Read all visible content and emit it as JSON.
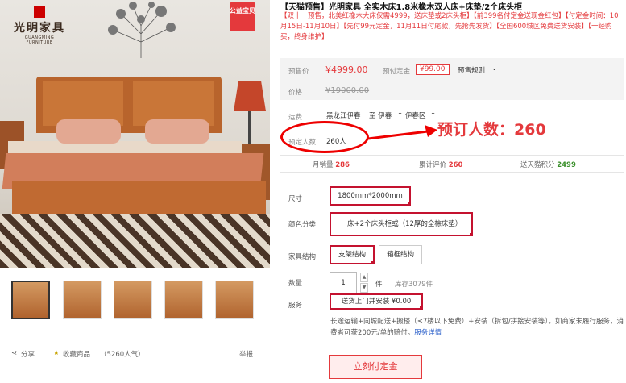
{
  "gallery": {
    "logo_cn": "光明家具",
    "logo_en": "GUANGMING FURNITURE",
    "promo_badge": "公益宝贝",
    "thumbnail_count": 5,
    "share_label": "分享",
    "favorite_label": "收藏商品",
    "favorite_count": "（5260人气）",
    "report_label": "举报"
  },
  "product": {
    "title": "【天猫预售】光明家具 全实木床1.8米橡木双人床+床垫/2个床头柜",
    "subtitle": "【双十一预售，北美红橡木大床仅需4999，送床垫或2床头柜】【前399名付定金送现金红包】【付定金时间：10月15日-11月10日】【先付99元定金，11月11日付尾款，先抢先发货】【全国600城区免费送货安装】【一经购买，终身维护】"
  },
  "price": {
    "presale_label": "预售价",
    "presale_price": "¥4999.00",
    "deposit_label": "预付定金",
    "deposit_price": "¥99.00",
    "rule_label": "预售规则",
    "original_label": "价格",
    "original_price": "¥19000.00"
  },
  "shipping": {
    "label": "运费",
    "from": "黑龙江伊春",
    "to": "至 伊春",
    "district": "伊春区"
  },
  "reservation": {
    "label": "预定人数",
    "count": "260人",
    "callout": "预订人数：260"
  },
  "stats": {
    "monthly_label": "月销量",
    "monthly_value": "286",
    "reviews_label": "累计评价",
    "reviews_value": "260",
    "points_label": "送天猫积分",
    "points_value": "2499"
  },
  "options": {
    "size_label": "尺寸",
    "size_value": "1800mm*2000mm",
    "color_label": "颜色分类",
    "color_value": "一床+2个床头柜或（12厚的全棕床垫）",
    "structure_label": "家具结构",
    "structure_options": [
      "支架结构",
      "箱框结构"
    ],
    "qty_label": "数量",
    "qty_value": "1",
    "qty_unit": "件",
    "stock": "库存3079件",
    "service_label": "服务",
    "service_value": "送货上门并安装 ¥0.00"
  },
  "service_desc": {
    "text": "长途运输+同城配送+搬楼（≤7楼以下免费）+安装（拆包/拼接安装等）。如商家未履行服务，消费者可获200元/单的赔付。",
    "link": "服务详情"
  },
  "buy_button": "立刻付定金",
  "colors": {
    "accent": "#e4393c",
    "points": "#3a8f2a"
  }
}
